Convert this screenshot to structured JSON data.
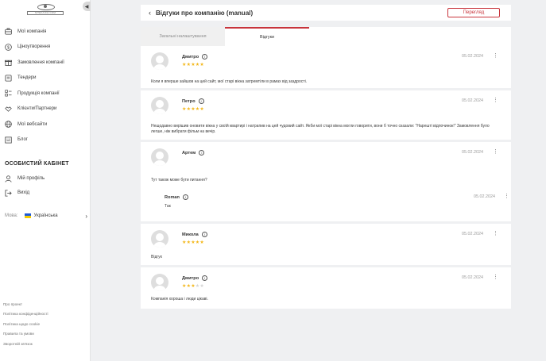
{
  "sidebar": {
    "logo_text": "SITEKAICH.COM",
    "items": [
      {
        "label": "Мої компанія",
        "icon": "briefcase-icon"
      },
      {
        "label": "Ціноутворення",
        "icon": "dollar-icon"
      },
      {
        "label": "Замовлення компанії",
        "icon": "gift-icon"
      },
      {
        "label": "Тендери",
        "icon": "document-icon"
      },
      {
        "label": "Продукція компанії",
        "icon": "grid-list-icon"
      },
      {
        "label": "Клієнти/Партнери",
        "icon": "handshake-icon"
      },
      {
        "label": "Мої вебсайти",
        "icon": "globe-icon"
      },
      {
        "label": "Блог",
        "icon": "blog-icon"
      }
    ],
    "cabinet_title": "ОСОБИСТИЙ КАБІНЕТ",
    "cabinet_items": [
      {
        "label": "Мій профіль",
        "icon": "user-icon"
      },
      {
        "label": "Вихід",
        "icon": "logout-icon"
      }
    ],
    "language_label": "Мова:",
    "language_value": "Українська",
    "footer_links": [
      "Про проект",
      "Політика конфіденційності",
      "Політика щодо cookie",
      "Правила та умови",
      "Зворотній зв'язок"
    ]
  },
  "header": {
    "back_icon": "chevron-left-icon",
    "title": "Відгуки про компанію (manual)",
    "view_button": "Перегляд"
  },
  "tabs": [
    {
      "label": "Загальні налаштування",
      "active": false
    },
    {
      "label": "Відгуки",
      "active": true
    }
  ],
  "reviews": [
    {
      "name": "Дмитро",
      "rating": 5,
      "date": "05.02.2024",
      "text": "Коли я вперше зайшов на цей сайт, мої старі вікна затремтіли в рамах від заздрості."
    },
    {
      "name": "Петро",
      "rating": 5,
      "date": "05.02.2024",
      "text": "Нещодавно вирішив оновити вікна у своїй квартирі і натрапив на цей чудовий сайт. Якби мої старі вікна могли говорити, вони б точно сказали: \"Нарешті відпочинок!\" Замовлення було легше, ніж вибрати фільм на вечір."
    },
    {
      "name": "Артем",
      "rating": 0,
      "date": "05.02.2024",
      "text": "Тут також може бути питання?",
      "reply": {
        "name": "Roman",
        "date": "05.02.2024",
        "text": "Так"
      }
    },
    {
      "name": "Микола",
      "rating": 5,
      "date": "05.02.2024",
      "text": "Відгук"
    },
    {
      "name": "Дмитро",
      "rating": 3,
      "date": "05.02.2024",
      "text": "Компанія хороша і люди цікаві."
    }
  ],
  "colors": {
    "accent": "#c8343b",
    "star": "#f3b71a"
  }
}
